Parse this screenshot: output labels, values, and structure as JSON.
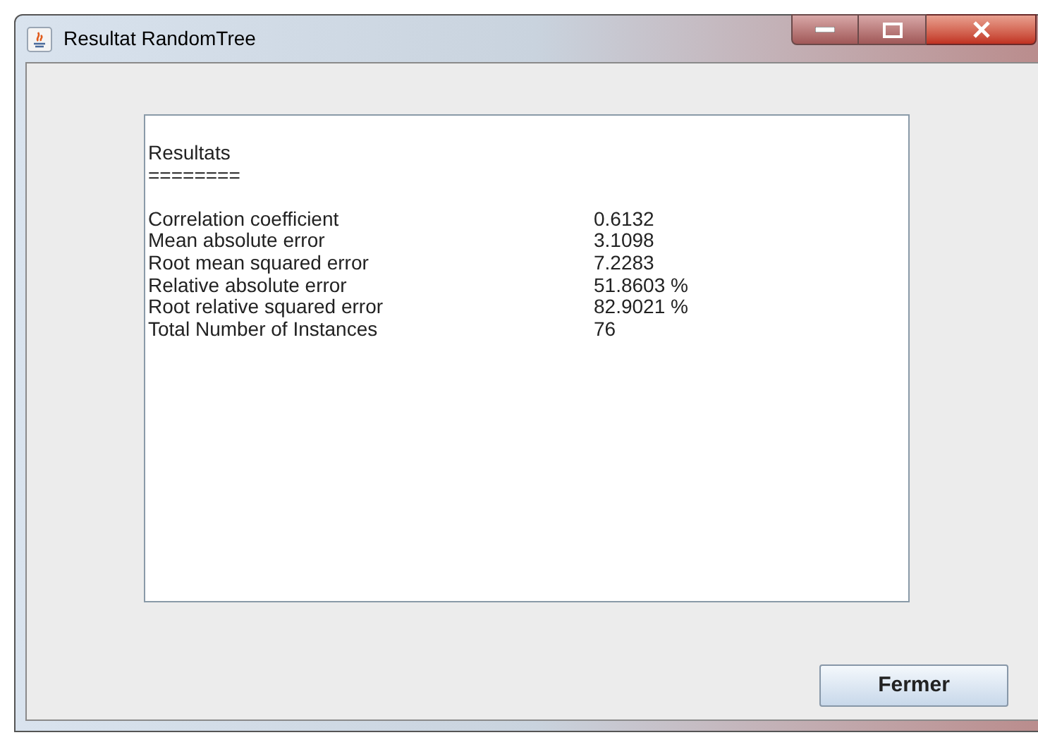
{
  "window": {
    "title": "Resultat RandomTree"
  },
  "results": {
    "heading": "Resultats",
    "underline": "========",
    "rows": [
      {
        "label": "Correlation coefficient",
        "value": "0.6132"
      },
      {
        "label": "Mean absolute error",
        "value": "3.1098"
      },
      {
        "label": "Root mean squared error",
        "value": "7.2283"
      },
      {
        "label": "Relative absolute error",
        "value": "51.8603 %"
      },
      {
        "label": "Root relative squared error",
        "value": "82.9021 %"
      },
      {
        "label": "Total Number of Instances",
        "value": "76"
      }
    ]
  },
  "buttons": [
    "Fermer"
  ]
}
